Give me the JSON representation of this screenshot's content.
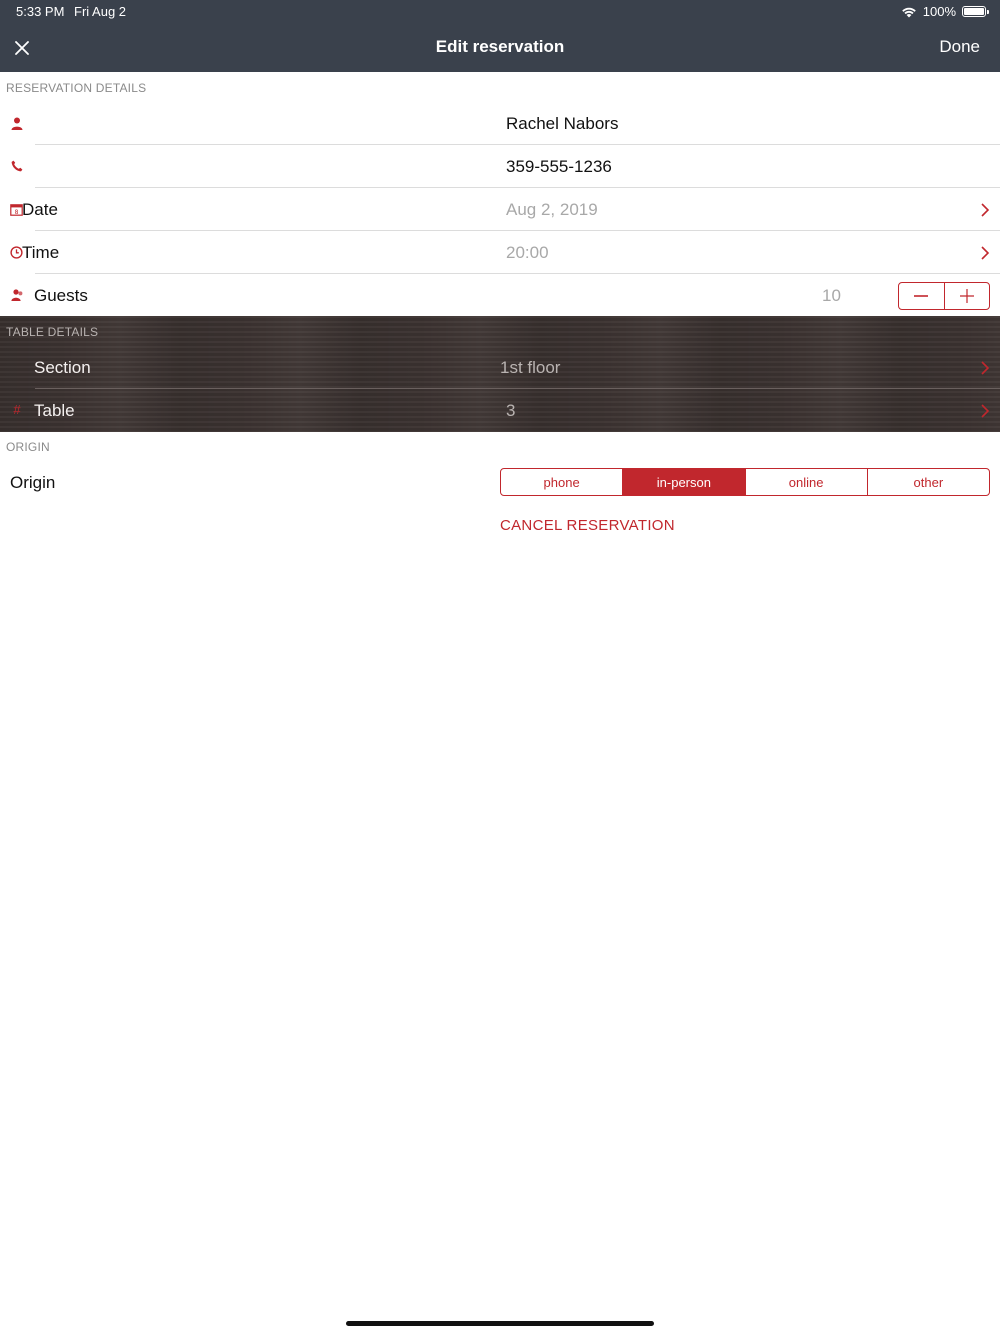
{
  "status_bar": {
    "time": "5:33 PM",
    "date": "Fri Aug 2",
    "battery": "100%"
  },
  "nav": {
    "title": "Edit reservation",
    "done_label": "Done",
    "close_icon": "close-icon"
  },
  "reservation_details": {
    "header": "RESERVATION DETAILS",
    "name": "Rachel Nabors",
    "phone": "359-555-1236",
    "date_label": "Date",
    "date_value": "Aug 2, 2019",
    "time_label": "Time",
    "time_value": "20:00",
    "guests_label": "Guests",
    "guests_value": "10"
  },
  "table_details": {
    "header": "TABLE DETAILS",
    "section_label": "Section",
    "section_value": "1st floor",
    "table_icon": "#",
    "table_label": "Table",
    "table_value": "3"
  },
  "origin": {
    "header": "ORIGIN",
    "label": "Origin",
    "options": [
      "phone",
      "in-person",
      "online",
      "other"
    ],
    "selected": "in-person"
  },
  "cancel_label": "CANCEL RESERVATION",
  "colors": {
    "accent": "#c1272d",
    "navbar": "#3a414c",
    "wood": "#3b3230"
  }
}
